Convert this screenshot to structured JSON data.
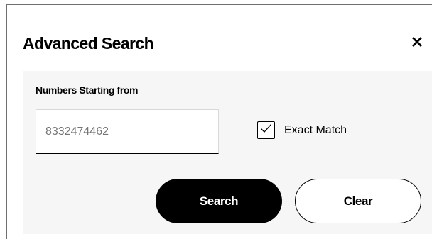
{
  "dialog": {
    "title": "Advanced Search",
    "close_icon": "close-icon"
  },
  "form": {
    "numbers_label": "Numbers Starting from",
    "numbers_value": "8332474462",
    "exact_match_label": "Exact Match",
    "exact_match_checked": true,
    "checkbox_icon": "checkmark-icon"
  },
  "actions": {
    "search_label": "Search",
    "clear_label": "Clear"
  },
  "colors": {
    "primary_button_bg": "#000000",
    "panel_bg": "#f6f6f6",
    "input_text": "#747676"
  }
}
